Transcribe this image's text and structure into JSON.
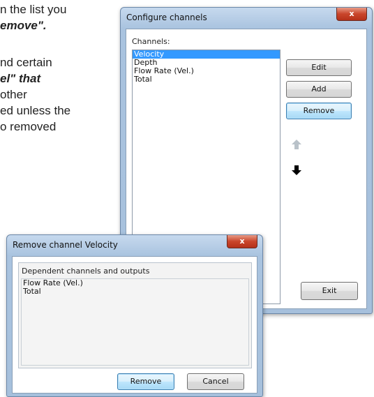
{
  "document": {
    "lines": [
      "n the list you",
      "emove\".",
      "nd certain",
      "el\" that",
      "other",
      "ed unless the",
      "o removed"
    ]
  },
  "configure_dialog": {
    "title": "Configure channels",
    "close_glyph": "x",
    "channels_label": "Channels:",
    "channels": [
      "Velocity",
      "Depth",
      "Flow Rate (Vel.)",
      "Total"
    ],
    "selected_channel": "Velocity",
    "edit_label": "Edit",
    "add_label": "Add",
    "remove_label": "Remove",
    "exit_label": "Exit",
    "move_up_icon": "arrow-up-icon",
    "move_down_icon": "arrow-down-icon"
  },
  "remove_dialog": {
    "title": "Remove channel Velocity",
    "close_glyph": "x",
    "group_label": "Dependent channels and outputs",
    "dependents": [
      "Flow Rate (Vel.)",
      "Total"
    ],
    "remove_label": "Remove",
    "cancel_label": "Cancel"
  },
  "colors": {
    "selection": "#3399ff",
    "close_button": "#c9452b",
    "window_frame": "#a9c3df"
  }
}
